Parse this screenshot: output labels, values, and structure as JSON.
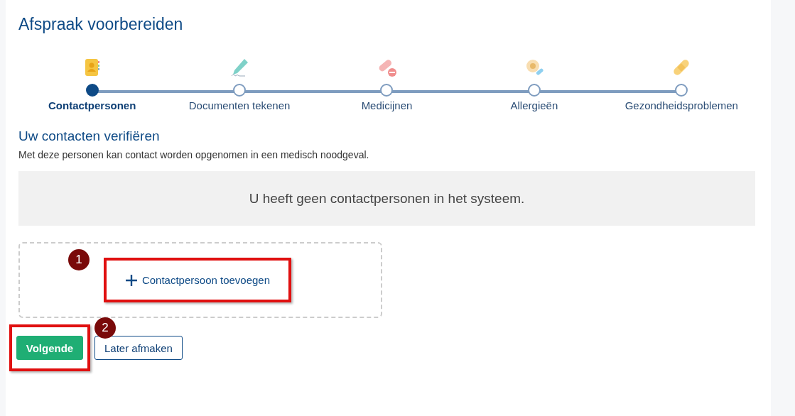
{
  "title": "Afspraak voorbereiden",
  "steps": [
    {
      "label": "Contactpersonen",
      "kind": "contacts",
      "selected": true
    },
    {
      "label": "Documenten tekenen",
      "kind": "pen",
      "selected": false
    },
    {
      "label": "Medicijnen",
      "kind": "pills",
      "selected": false
    },
    {
      "label": "Allergieën",
      "kind": "flower",
      "selected": false
    },
    {
      "label": "Gezondheidsproblemen",
      "kind": "bandage",
      "selected": false
    }
  ],
  "section": {
    "heading": "Uw contacten verifiëren",
    "description": "Met deze personen kan contact worden opgenomen in een medisch noodgeval.",
    "empty_message": "U heeft geen contactpersonen in het systeem."
  },
  "add_button": {
    "label": "Contactpersoon toevoegen",
    "annotation": "1"
  },
  "buttons": [
    {
      "label": "Volgende",
      "kind": "primary",
      "annotation": "2"
    },
    {
      "label": "Later afmaken",
      "kind": "secondary"
    }
  ]
}
